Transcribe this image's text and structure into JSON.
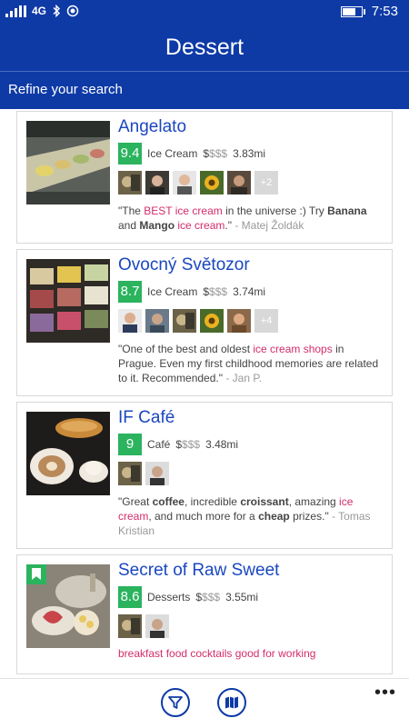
{
  "status": {
    "network": "4G",
    "time": "7:53",
    "battery_level": 0.8
  },
  "header": {
    "title": "Dessert"
  },
  "refine": {
    "label": "Refine your search"
  },
  "places": [
    {
      "name": "Angelato",
      "score": "9.4",
      "category": "Ice Cream",
      "price": {
        "active": "$",
        "inactive": "$$$"
      },
      "distance": "3.83mi",
      "extra_count": "+2",
      "review": {
        "t1": "\"The ",
        "h1": "BEST ice cream",
        "t2": " in the universe :) Try ",
        "b1": "Banana",
        "t3": " and ",
        "b2": "Mango",
        "t4": " ",
        "h2": "ice cream",
        "t5": ".\"",
        "author": " - Matej Žoldák"
      }
    },
    {
      "name": "Ovocný Světozor",
      "score": "8.7",
      "category": "Ice Cream",
      "price": {
        "active": "$",
        "inactive": "$$$"
      },
      "distance": "3.74mi",
      "extra_count": "+4",
      "review": {
        "t1": "\"One of the best and oldest ",
        "h1": "ice cream shops",
        "t2": " in Prague. Even my first childhood memories are related to it. Recommended.\"",
        "author": " - Jan P."
      }
    },
    {
      "name": "IF Café",
      "score": "9",
      "category": "Café",
      "price": {
        "active": "$",
        "inactive": "$$$"
      },
      "distance": "3.48mi",
      "review": {
        "t1": "\"Great ",
        "b1": "coffee",
        "t2": ", incredible ",
        "b2": "croissant",
        "t3": ", amazing ",
        "h1": "ice cream",
        "t4": ", and much more for a ",
        "b3": "cheap",
        "t5": " prizes.\"",
        "author": " - Tomas Kristian"
      }
    },
    {
      "name": "Secret of Raw Sweet",
      "score": "8.6",
      "category": "Desserts",
      "price": {
        "active": "$",
        "inactive": "$$$"
      },
      "distance": "3.55mi",
      "tags": "breakfast food cocktails good for working"
    }
  ],
  "appbar": {
    "more": "•••",
    "filter_icon": "filter-icon",
    "map_icon": "map-icon"
  }
}
